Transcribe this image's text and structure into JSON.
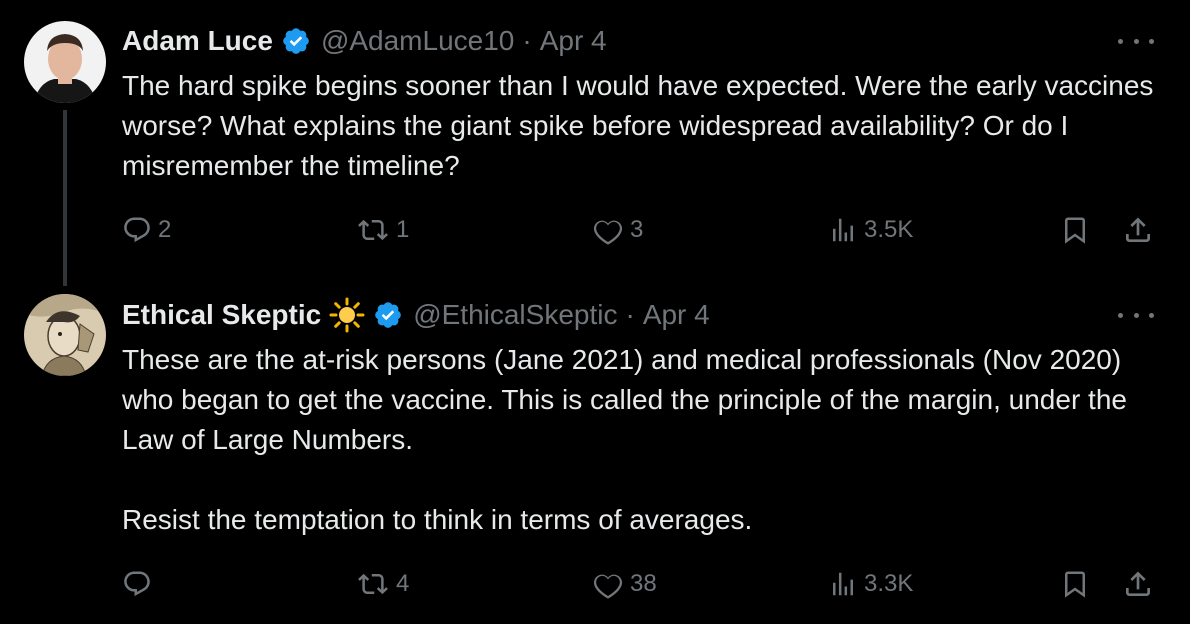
{
  "tweets": [
    {
      "name": "Adam Luce",
      "handle": "@AdamLuce10",
      "separator": "·",
      "date": "Apr 4",
      "text": "The hard spike begins sooner than I would have expected. Were the early vaccines worse? What explains the giant spike before widespread availability? Or do I misremember the timeline?",
      "replies": "2",
      "reposts": "1",
      "likes": "3",
      "views": "3.5K"
    },
    {
      "name": "Ethical Skeptic",
      "handle": "@EthicalSkeptic",
      "separator": "·",
      "date": "Apr 4",
      "text": "These are the at-risk persons (Jane 2021) and medical professionals (Nov 2020) who began to get the vaccine. This is called the principle of the margin, under the Law of Large Numbers.\n\nResist the temptation to think in terms of averages.",
      "replies": "",
      "reposts": "4",
      "likes": "38",
      "views": "3.3K"
    }
  ],
  "colors": {
    "background": "#000000",
    "text": "#e7e9ea",
    "muted": "#71767b",
    "verified": "#1d9bf0",
    "thread_line": "#333639"
  },
  "icons": [
    "verified-badge-icon",
    "sun-emoji-icon",
    "more-icon",
    "reply-icon",
    "repost-icon",
    "like-icon",
    "views-icon",
    "bookmark-icon",
    "share-icon"
  ]
}
